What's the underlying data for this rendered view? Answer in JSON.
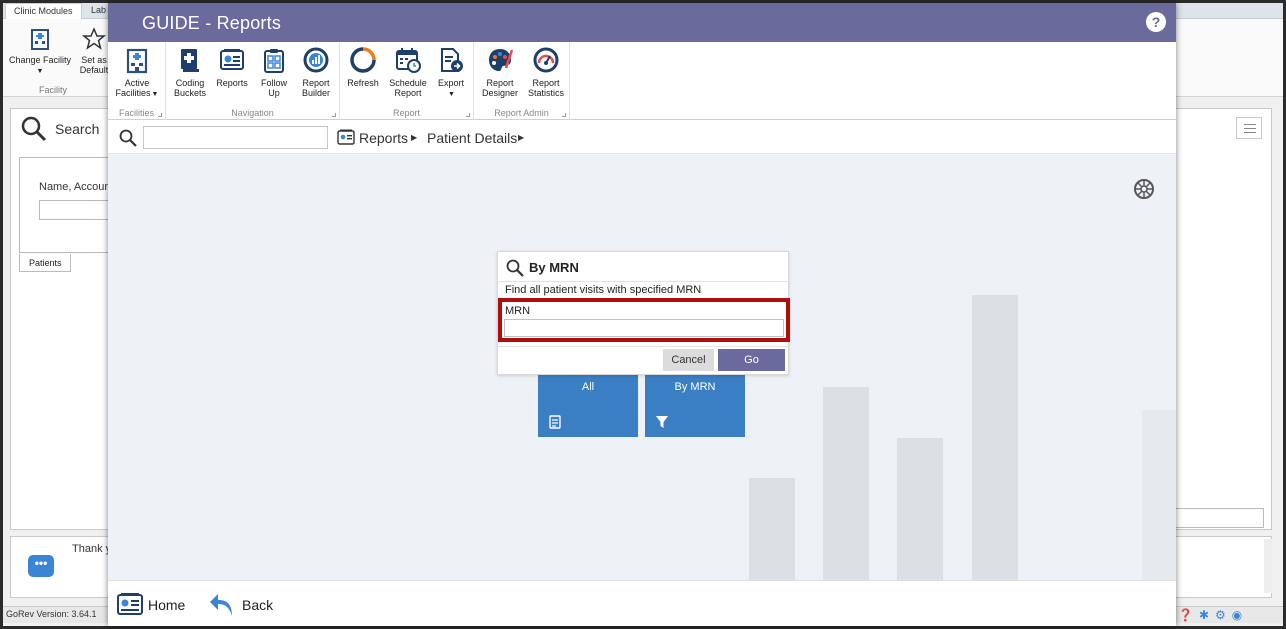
{
  "background": {
    "tabs": [
      "Clinic Modules",
      "Lab"
    ],
    "ribbon_buttons": [
      "Change Facility",
      "Set as Default"
    ],
    "ribbon_group": "Facility",
    "search_title": "Search",
    "search_field_label": "Name, Accoun",
    "patients_tab": "Patients",
    "chat_text": "Thank y",
    "version": "GoRev Version: 3.64.1"
  },
  "window": {
    "title": "GUIDE - Reports",
    "help": "?"
  },
  "ribbon": {
    "groups": [
      {
        "label": "Facilities",
        "buttons": [
          {
            "line1": "Active",
            "line2": "Facilities",
            "icon": "building-icon",
            "caret": true
          }
        ]
      },
      {
        "label": "Navigation",
        "buttons": [
          {
            "line1": "Coding",
            "line2": "Buckets",
            "icon": "coding-buckets-icon"
          },
          {
            "line1": "Reports",
            "line2": "",
            "icon": "reports-icon"
          },
          {
            "line1": "Follow",
            "line2": "Up",
            "icon": "clipboard-icon"
          },
          {
            "line1": "Report",
            "line2": "Builder",
            "icon": "report-builder-icon"
          }
        ]
      },
      {
        "label": "Report",
        "buttons": [
          {
            "line1": "Refresh",
            "line2": "",
            "icon": "refresh-icon"
          },
          {
            "line1": "Schedule",
            "line2": "Report",
            "icon": "calendar-icon"
          },
          {
            "line1": "Export",
            "line2": "",
            "icon": "export-icon",
            "caret": true
          }
        ]
      },
      {
        "label": "Report Admin",
        "buttons": [
          {
            "line1": "Report",
            "line2": "Designer",
            "icon": "palette-icon"
          },
          {
            "line1": "Report",
            "line2": "Statistics",
            "icon": "gauge-icon"
          }
        ]
      }
    ]
  },
  "breadcrumb": {
    "search_placeholder": "",
    "items": [
      "Reports",
      "Patient Details"
    ]
  },
  "tiles": [
    {
      "label": "All",
      "icon": "document-icon"
    },
    {
      "label": "By MRN",
      "icon": "filter-icon"
    }
  ],
  "dialog": {
    "title": "By MRN",
    "description": "Find all patient visits with specified MRN",
    "field_label": "MRN",
    "field_value": "",
    "cancel_label": "Cancel",
    "go_label": "Go"
  },
  "footer": {
    "home_label": "Home",
    "back_label": "Back"
  },
  "colors": {
    "titlebar": "#6b6a9c",
    "tile": "#3a7fc4",
    "highlight": "#b00d0d"
  }
}
